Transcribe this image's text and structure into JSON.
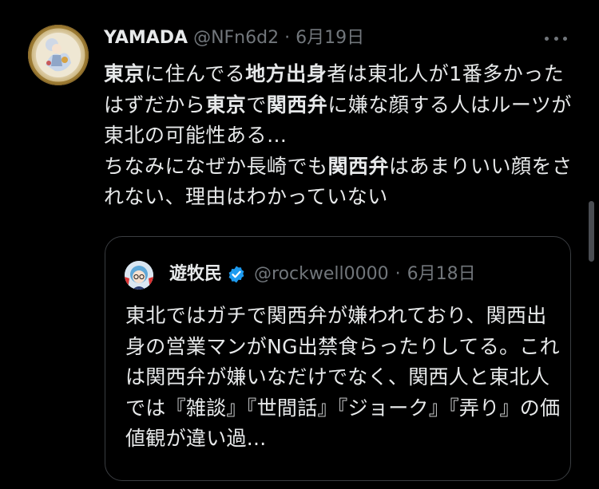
{
  "tweet": {
    "author_name": "YAMADA",
    "handle": "@NFn6d2",
    "separator": "·",
    "date": "6月19日",
    "text_segments": [
      {
        "text": "東京",
        "bold": true
      },
      {
        "text": "に住んでる",
        "bold": false
      },
      {
        "text": "地方出身",
        "bold": true
      },
      {
        "text": "者は東北人が1番多かったはずだから",
        "bold": false
      },
      {
        "text": "東京",
        "bold": true
      },
      {
        "text": "で",
        "bold": false
      },
      {
        "text": "関西弁",
        "bold": true
      },
      {
        "text": "に嫌な顔する人はルーツが東北の可能性ある…",
        "bold": false
      },
      {
        "text": "\n",
        "bold": false
      },
      {
        "text": "ちなみになぜか長崎でも",
        "bold": false
      },
      {
        "text": "関西弁",
        "bold": true
      },
      {
        "text": "はあまりいい顔をされない、理由はわかっていない",
        "bold": false
      }
    ]
  },
  "quoted": {
    "author_name": "遊牧民",
    "verified": true,
    "handle": "@rockwell0000",
    "separator": "·",
    "date": "6月18日",
    "text": "東北ではガチで関西弁が嫌われており、関西出身の営業マンがNG出禁食らったりしてる。これは関西弁が嫌いなだけでなく、関西人と東北人では『雑談』『世間話』『ジョーク』『弄り』の価値観が違い過..."
  },
  "colors": {
    "background": "#000000",
    "text": "#e7e9ea",
    "muted": "#71767b",
    "border": "#3a3d41",
    "verified": "#1d9bf0"
  },
  "icons": {
    "more": "more-horizontal-icon",
    "verified": "verified-badge-icon"
  }
}
